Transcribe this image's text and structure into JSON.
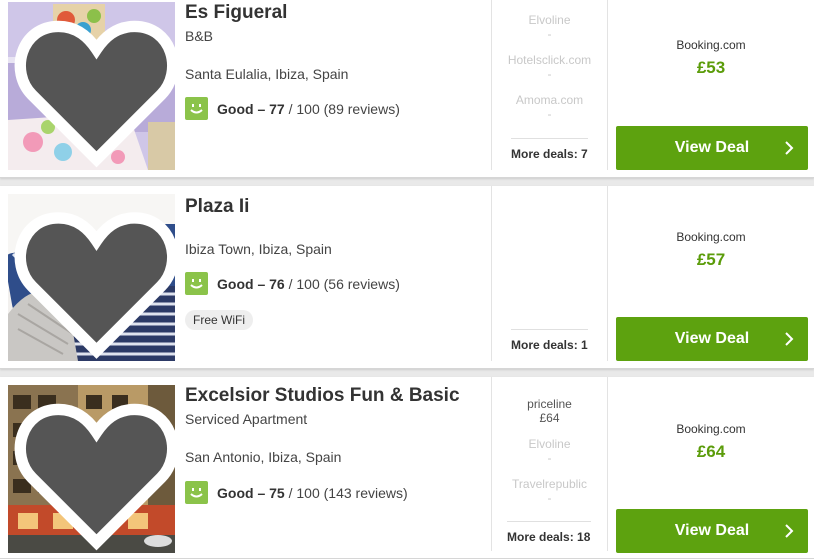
{
  "colors": {
    "accent": "#5da20f",
    "price": "#5b9c0a",
    "rating_face": "#8bc34a"
  },
  "hotels": [
    {
      "name": "Es Figueral",
      "type": "B&B",
      "location": "Santa Eulalia, Ibiza, Spain",
      "rating_word": "Good",
      "rating_dash": "–",
      "score": "77",
      "score_rest": "/ 100 (89 reviews)",
      "amenity": "",
      "other_deals": [
        {
          "site": "Elvoline",
          "price": "-"
        },
        {
          "site": "Hotelsclick.com",
          "price": "-"
        },
        {
          "site": "Amoma.com",
          "price": "-"
        }
      ],
      "more_deals": "More deals: 7",
      "best_site": "Booking.com",
      "best_price": "£53",
      "cta": "View Deal"
    },
    {
      "name": "Plaza Ii",
      "type": "",
      "location": "Ibiza Town, Ibiza, Spain",
      "rating_word": "Good",
      "rating_dash": "–",
      "score": "76",
      "score_rest": "/ 100 (56 reviews)",
      "amenity": "Free WiFi",
      "other_deals": [],
      "more_deals": "More deals: 1",
      "best_site": "Booking.com",
      "best_price": "£57",
      "cta": "View Deal"
    },
    {
      "name": "Excelsior Studios Fun & Basic",
      "type": "Serviced Apartment",
      "location": "San Antonio, Ibiza, Spain",
      "rating_word": "Good",
      "rating_dash": "–",
      "score": "75",
      "score_rest": "/ 100 (143 reviews)",
      "amenity": "",
      "other_deals": [
        {
          "site": "priceline",
          "price": "£64"
        },
        {
          "site": "Elvoline",
          "price": "-"
        },
        {
          "site": "Travelrepublic",
          "price": "-"
        }
      ],
      "more_deals": "More deals: 18",
      "best_site": "Booking.com",
      "best_price": "£64",
      "cta": "View Deal"
    }
  ]
}
